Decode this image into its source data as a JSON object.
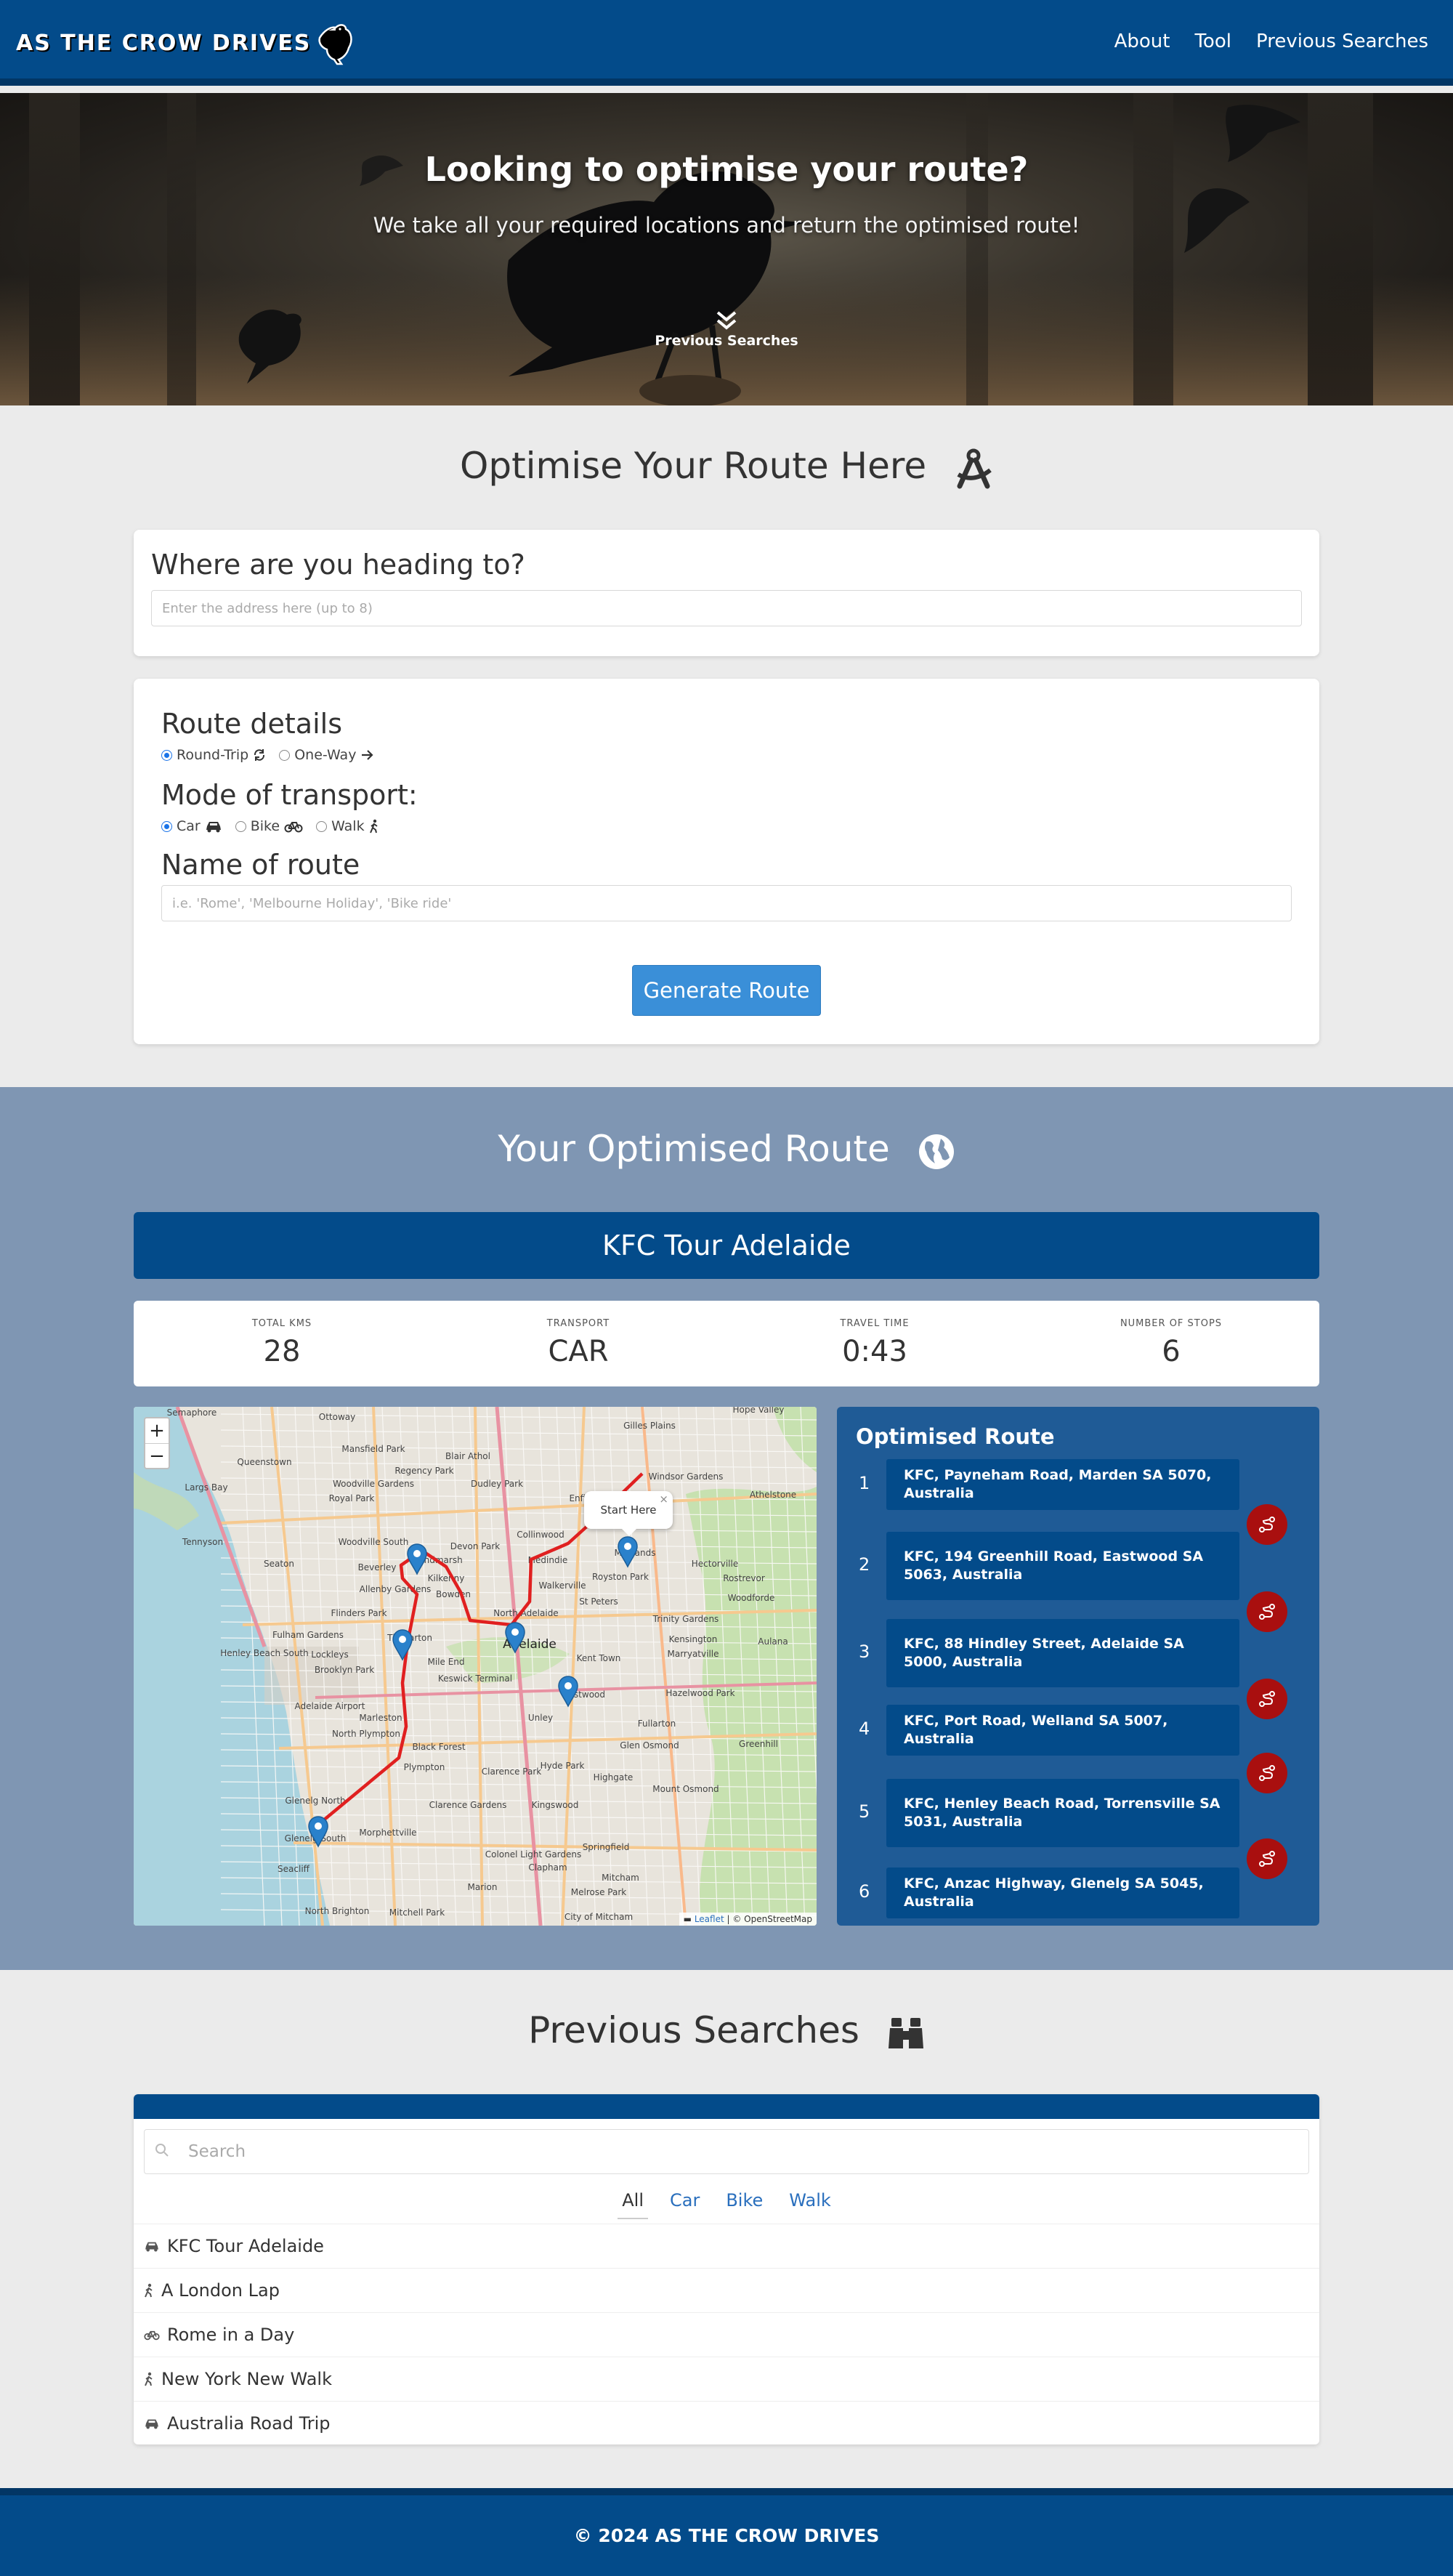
{
  "nav": {
    "brand": "AS THE CROW DRIVES",
    "links": [
      "About",
      "Tool",
      "Previous Searches"
    ]
  },
  "hero": {
    "title": "Looking to optimise your route?",
    "subtitle": "We take all your required locations and return the optimised route!",
    "scroll_label": "Previous Searches"
  },
  "optimise": {
    "title": "Optimise Your Route Here",
    "destination_heading": "Where are you heading to?",
    "destination_placeholder": "Enter the address here (up to 8)",
    "route_details_heading": "Route details",
    "route_options": [
      {
        "label": "Round-Trip",
        "selected": true
      },
      {
        "label": "One-Way",
        "selected": false
      }
    ],
    "transport_heading": "Mode of transport:",
    "transport_options": [
      {
        "label": "Car",
        "selected": true
      },
      {
        "label": "Bike",
        "selected": false
      },
      {
        "label": "Walk",
        "selected": false
      }
    ],
    "name_heading": "Name of route",
    "name_placeholder": "i.e. 'Rome', 'Melbourne Holiday', 'Bike ride'",
    "generate_label": "Generate Route"
  },
  "result": {
    "title": "Your Optimised Route",
    "route_name": "KFC Tour Adelaide",
    "stats": [
      {
        "label": "TOTAL KMS",
        "value": "28"
      },
      {
        "label": "TRANSPORT",
        "value": "CAR"
      },
      {
        "label": "TRAVEL TIME",
        "value": "0:43"
      },
      {
        "label": "NUMBER OF STOPS",
        "value": "6"
      }
    ],
    "map": {
      "zoom_in": "+",
      "zoom_out": "−",
      "popup": "Start Here",
      "popup_close": "×",
      "attribution_leaflet": "Leaflet",
      "attribution_rest": " | © OpenStreetMap",
      "labels": [
        "Semaphore",
        "Ottoway",
        "Gilles Plains",
        "Hope Valley",
        "Queenstown",
        "Mansfield Park",
        "Blair Athol",
        "Windsor Gardens",
        "Woodville Gardens",
        "Regency Park",
        "Athelstone",
        "Dudley Park",
        "Largs Bay",
        "Royal Park",
        "Enfield",
        "Tennyson",
        "Woodville South",
        "Devon Park",
        "Collinwood",
        "Hindmarsh",
        "Medindie",
        "Maylands",
        "Hectorville",
        "Seaton",
        "Beverley",
        "Kilkenny",
        "Walkerville",
        "Rostrevor",
        "Allenby Gardens",
        "Bowden",
        "Royston Park",
        "Woodforde",
        "Flinders Park",
        "North Adelaide",
        "St Peters",
        "Trinity Gardens",
        "Fulham Gardens",
        "Thebarton",
        "Adelaide",
        "Kensington",
        "Aulana",
        "Henley Beach South",
        "Lockleys",
        "Mile End",
        "Kent Town",
        "Marryatville",
        "Brooklyn Park",
        "Keswick Terminal",
        "Eastwood",
        "Hazelwood Park",
        "Adelaide Airport",
        "Marleston",
        "Unley",
        "Fullarton",
        "North Plympton",
        "Black Forest",
        "Glen Osmond",
        "Plympton",
        "Clarence Park",
        "Hyde Park",
        "Greenhill",
        "Highgate",
        "Mount Osmond",
        "Glenelg North",
        "Clarence Gardens",
        "Kingswood",
        "Glenelg South",
        "Morphettville",
        "Colonel Light Gardens",
        "Springfield",
        "Clapham",
        "Mitcham",
        "Seacliff",
        "Marion",
        "North Brighton",
        "Mitchell Park",
        "Melrose Park",
        "City of Mitcham"
      ]
    },
    "panel_title": "Optimised Route",
    "stops": [
      "KFC, Payneham Road, Marden SA 5070, Australia",
      "KFC, 194 Greenhill Road, Eastwood SA 5063, Australia",
      "KFC, 88 Hindley Street, Adelaide SA 5000, Australia",
      "KFC, Port Road, Welland SA 5007, Australia",
      "KFC, Henley Beach Road, Torrensville SA 5031, Australia",
      "KFC, Anzac Highway, Glenelg SA 5045, Australia"
    ]
  },
  "previous": {
    "title": "Previous Searches",
    "search_placeholder": "Search",
    "filters": [
      "All",
      "Car",
      "Bike",
      "Walk"
    ],
    "active_filter": "All",
    "items": [
      {
        "name": "KFC Tour Adelaide",
        "mode": "car"
      },
      {
        "name": "A London Lap",
        "mode": "walk"
      },
      {
        "name": "Rome in a Day",
        "mode": "bike"
      },
      {
        "name": "New York New Walk",
        "mode": "walk"
      },
      {
        "name": "Australia Road Trip",
        "mode": "car"
      }
    ]
  },
  "footer": "© 2024 AS THE CROW DRIVES",
  "colors": {
    "primary": "#034b8a",
    "accent_button": "#3a8fd8",
    "route_line": "#e02020",
    "go_button": "#a90f0f"
  }
}
